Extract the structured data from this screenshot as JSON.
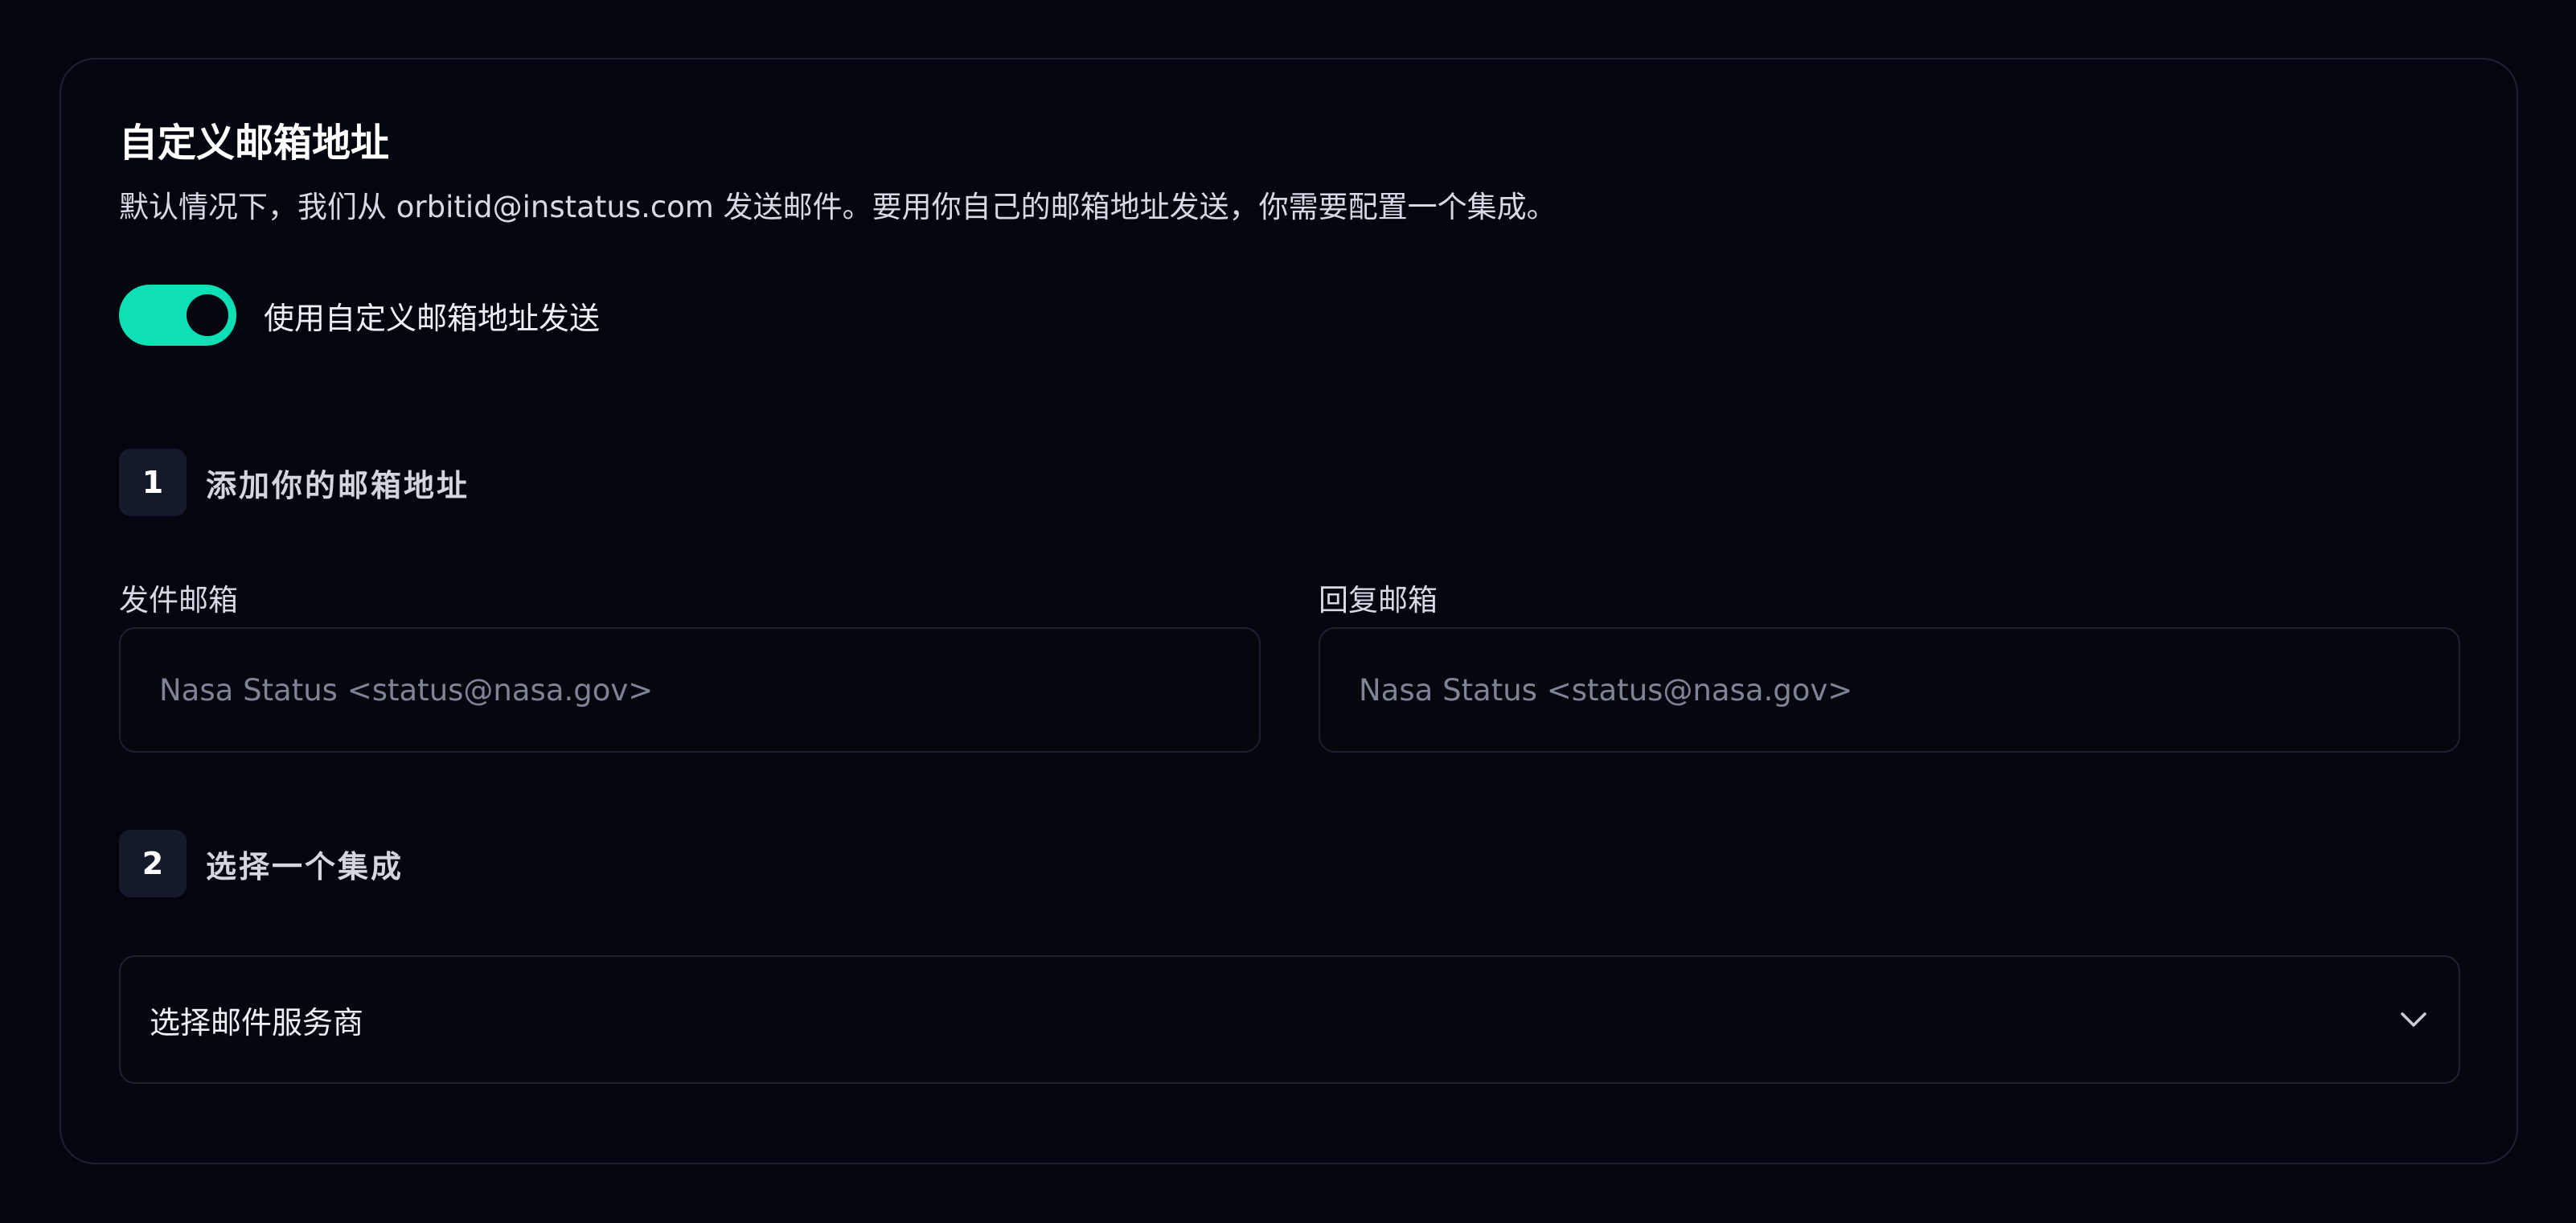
{
  "section": {
    "title": "自定义邮箱地址",
    "description": "默认情况下，我们从 orbitid@instatus.com 发送邮件。要用你自己的邮箱地址发送，你需要配置一个集成。"
  },
  "toggle": {
    "label": "使用自定义邮箱地址发送",
    "enabled": true,
    "color": "#0ee0b5"
  },
  "step1": {
    "number": "1",
    "title": "添加你的邮箱地址",
    "from_label": "发件邮箱",
    "from_placeholder": "Nasa Status <status@nasa.gov>",
    "reply_label": "回复邮箱",
    "reply_placeholder": "Nasa Status <status@nasa.gov>"
  },
  "step2": {
    "number": "2",
    "title": "选择一个集成",
    "select_value": "选择邮件服务商",
    "select_icon": "chevron-down-icon"
  }
}
